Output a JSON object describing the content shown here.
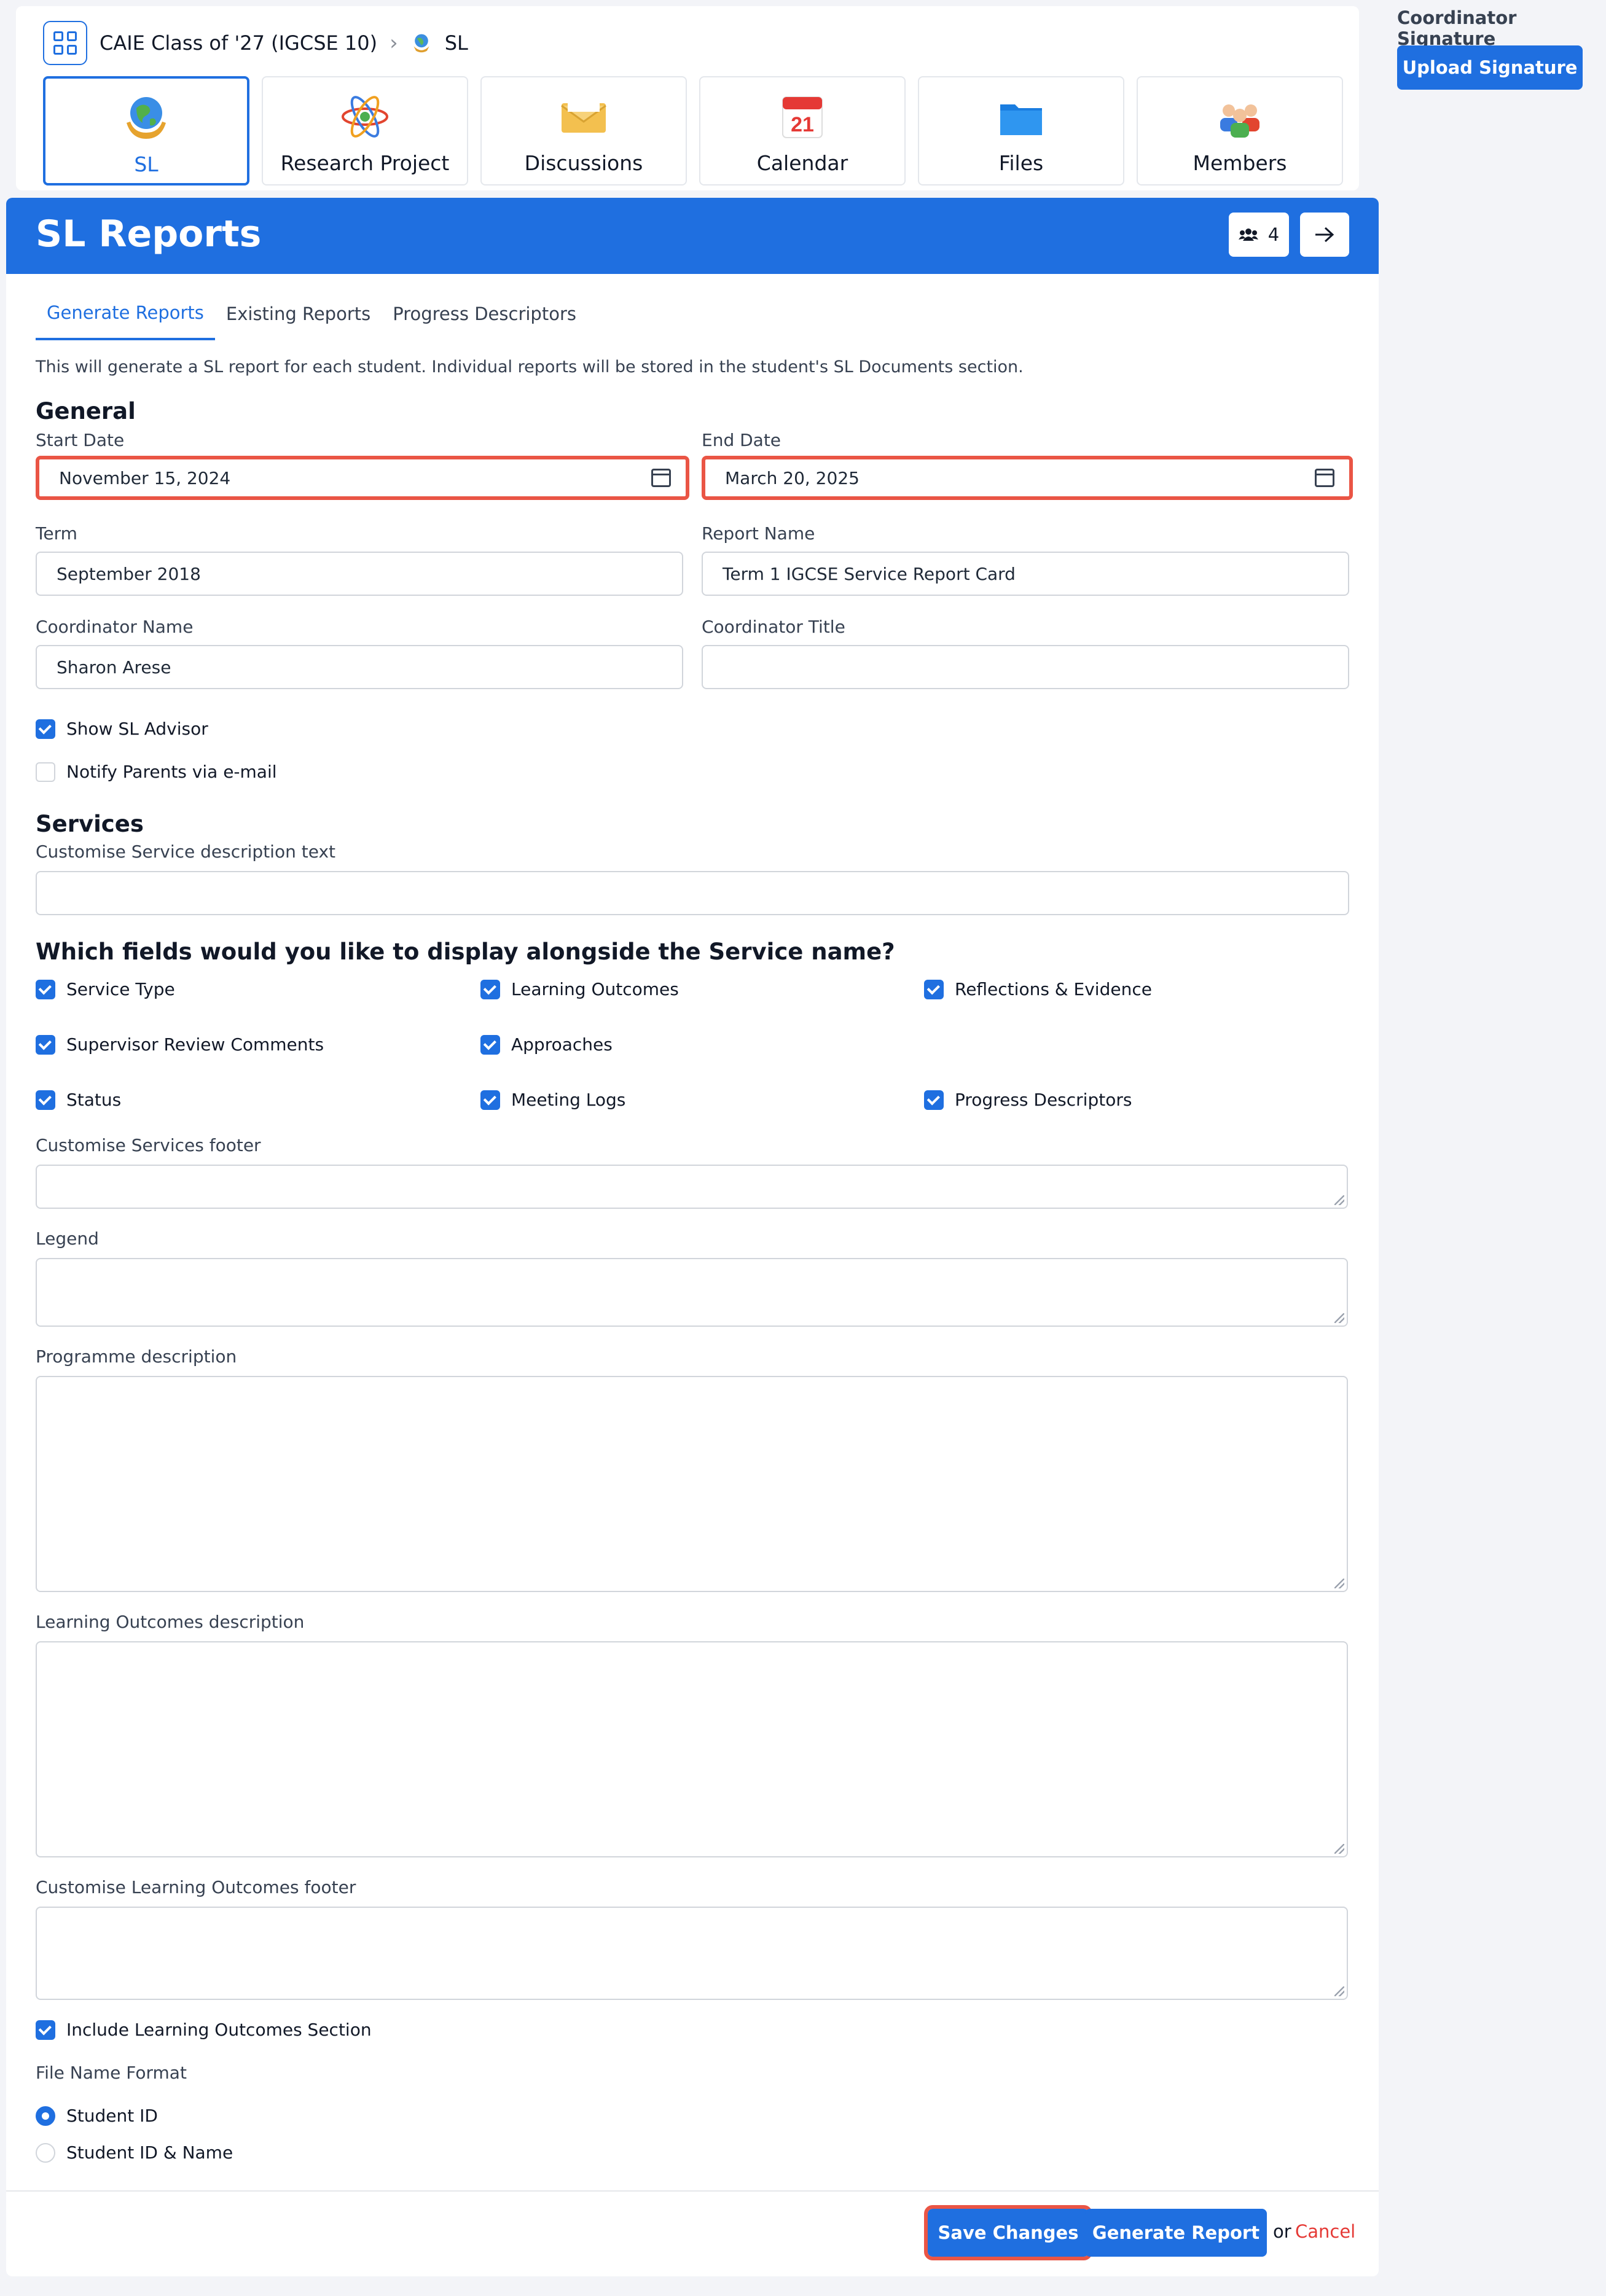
{
  "breadcrumb": {
    "group": "CAIE Class of '27 (IGCSE 10)",
    "current": "SL"
  },
  "tiles": [
    {
      "label": "SL",
      "icon": "globe-hands-icon",
      "active": true
    },
    {
      "label": "Research Project",
      "icon": "atom-icon",
      "active": false
    },
    {
      "label": "Discussions",
      "icon": "envelope-icon",
      "active": false
    },
    {
      "label": "Calendar",
      "icon": "calendar-icon",
      "active": false,
      "day": "21"
    },
    {
      "label": "Files",
      "icon": "folder-icon",
      "active": false
    },
    {
      "label": "Members",
      "icon": "people-icon",
      "active": false
    }
  ],
  "right_panel": {
    "signature_label": "Coordinator Signature",
    "upload_label": "Upload Signature"
  },
  "header": {
    "title": "SL Reports",
    "member_count": "4"
  },
  "tabs": [
    "Generate Reports",
    "Existing Reports",
    "Progress Descriptors"
  ],
  "intro": "This will generate a SL report for each student. Individual reports will be stored in the student's SL Documents section.",
  "general": {
    "title": "General",
    "start_date_label": "Start Date",
    "start_date": "November 15, 2024",
    "end_date_label": "End Date",
    "end_date": "March 20, 2025",
    "term_label": "Term",
    "term": "September 2018",
    "report_name_label": "Report Name",
    "report_name": "Term 1 IGCSE Service Report Card",
    "coordinator_name_label": "Coordinator Name",
    "coordinator_name": "Sharon Arese",
    "coordinator_title_label": "Coordinator Title",
    "coordinator_title": "",
    "show_advisor": "Show SL Advisor",
    "notify_parents": "Notify Parents via e-mail"
  },
  "services": {
    "title": "Services",
    "desc_label": "Customise Service description text",
    "fields_question": "Which fields would you like to display alongside the Service name?",
    "fields": [
      "Service Type",
      "Learning Outcomes",
      "Reflections & Evidence",
      "Supervisor Review Comments",
      "Approaches",
      "Status",
      "Meeting Logs",
      "Progress Descriptors"
    ],
    "footer_label": "Customise Services footer",
    "legend_label": "Legend",
    "programme_label": "Programme description",
    "lo_desc_label": "Learning Outcomes description",
    "lo_footer_label": "Customise Learning Outcomes footer",
    "include_lo": "Include Learning Outcomes Section",
    "file_name_label": "File Name Format",
    "file_options": [
      "Student ID",
      "Student ID & Name"
    ]
  },
  "actions": {
    "save": "Save Changes",
    "generate": "Generate Report",
    "or": "or",
    "cancel": "Cancel"
  },
  "colors": {
    "accent": "#1f6fe0",
    "highlight": "#ea5545",
    "cancel": "#e53935"
  }
}
